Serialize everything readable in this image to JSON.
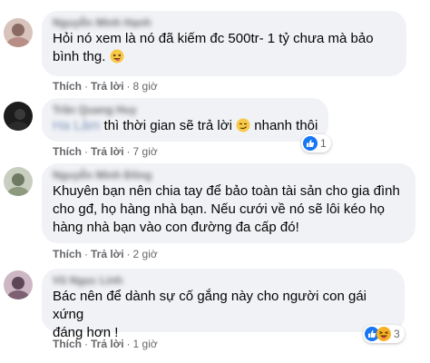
{
  "comments": [
    {
      "author": "Nguyễn Minh Hạnh",
      "text_lines": [
        "Hỏi nó xem là nó đã kiếm đc 500tr- 1 tỷ chưa mà bảo",
        "bình thg."
      ],
      "emoji": "laughing-tongue-emoji",
      "like_label": "Thích",
      "reply_label": "Trả lời",
      "time": "8 giờ"
    },
    {
      "author": "Trần Quang Huy",
      "mention": "Ha Lâm",
      "text": "thì thời gian sẽ trả lời",
      "text_after": "nhanh thôi",
      "emoji": "sly-face-emoji",
      "like_label": "Thích",
      "reply_label": "Trả lời",
      "time": "7 giờ",
      "reaction_count": "1",
      "reactions": [
        "like-icon"
      ]
    },
    {
      "author": "Nguyễn Minh Đông",
      "text_lines": [
        "Khuyên bạn nên chia tay để bảo toàn tài sản cho gia đình",
        "cho gđ, họ hàng nhà bạn. Nếu cưới về nó sẽ lôi kéo họ",
        "hàng nhà bạn vào con đường đa cấp đó!"
      ],
      "like_label": "Thích",
      "reply_label": "Trả lời",
      "time": "2 giờ"
    },
    {
      "author": "Vũ Ngọc Linh",
      "text_lines": [
        "Bác nên để dành sự cố gắng này cho người con gái xứng",
        "đáng hơn !"
      ],
      "like_label": "Thích",
      "reply_label": "Trả lời",
      "time": "1 giờ",
      "reaction_count": "3",
      "reactions": [
        "like-icon",
        "haha-icon"
      ]
    }
  ],
  "colors": {
    "bubble_bg": "#f0f2f5",
    "meta_text": "#65676b",
    "like_blue": "#1877f2",
    "haha_yellow": "#f7b125"
  }
}
